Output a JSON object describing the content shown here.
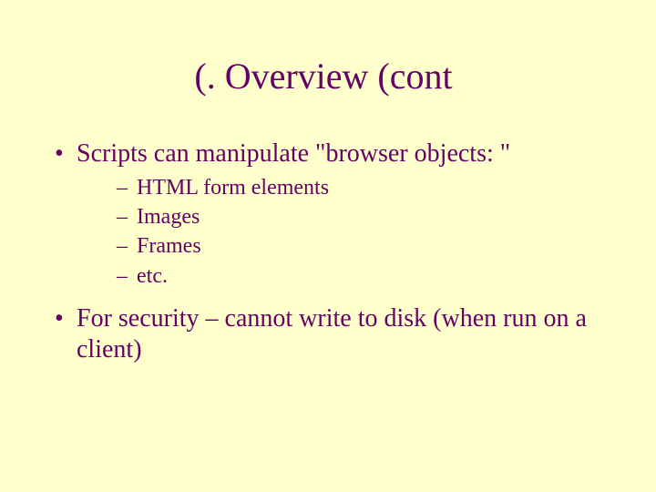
{
  "title": "(. Overview (cont",
  "bullets": [
    {
      "text": "Scripts can manipulate \"browser objects: \"",
      "sub": [
        "HTML form elements",
        "Images",
        "Frames",
        "etc."
      ]
    },
    {
      "text": "For security – cannot write to disk (when run on a client)",
      "sub": []
    }
  ]
}
